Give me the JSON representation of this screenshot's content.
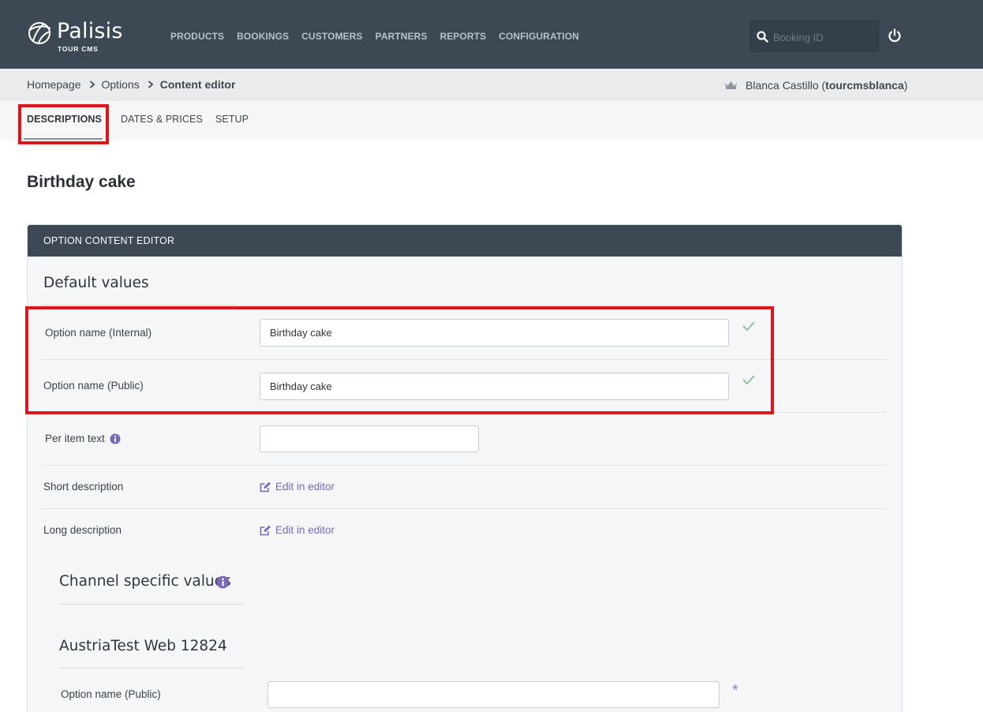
{
  "brand": {
    "name": "Palisis",
    "sub": "TOUR CMS"
  },
  "nav": {
    "items": [
      {
        "label": "PRODUCTS"
      },
      {
        "label": "BOOKINGS"
      },
      {
        "label": "CUSTOMERS"
      },
      {
        "label": "PARTNERS"
      },
      {
        "label": "REPORTS"
      },
      {
        "label": "CONFIGURATION"
      }
    ],
    "search_placeholder": "Booking ID",
    "search_icon": "search-icon",
    "power_icon": "power-icon"
  },
  "breadcrumb": {
    "home": "Homepage",
    "options": "Options",
    "current": "Content editor"
  },
  "user": {
    "name": "Blanca Castillo (",
    "username": "tourcmsblanca",
    "close": ")",
    "icon": "crown-icon"
  },
  "tabs": [
    {
      "label": "DESCRIPTIONS",
      "active": true
    },
    {
      "label": "DATES & PRICES",
      "active": false
    },
    {
      "label": "SETUP",
      "active": false
    }
  ],
  "page": {
    "title": "Birthday cake"
  },
  "panel": {
    "header": "OPTION CONTENT EDITOR",
    "default_title": "Default values",
    "fields": {
      "internal_name_label": "Option name (Internal)",
      "internal_name_value": "Birthday cake",
      "public_name_label": "Option name (Public)",
      "public_name_value": "Birthday cake",
      "per_item_label": "Per item text",
      "per_item_value": "",
      "short_desc_label": "Short description",
      "short_desc_link": "Edit in editor",
      "long_desc_label": "Long description",
      "long_desc_link": "Edit in editor"
    },
    "channel_title": "Channel specific values",
    "channel_name": "AustriaTest Web 12824",
    "channel_public_label": "Option name (Public)",
    "channel_public_value": "",
    "required_mark": "*"
  },
  "colors": {
    "nav_bg": "#3d4854",
    "accent": "#7c68b8",
    "highlight": "#e0151b",
    "check": "#8fc09a"
  }
}
